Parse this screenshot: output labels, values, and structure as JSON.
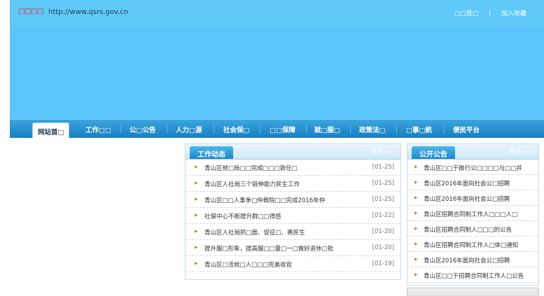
{
  "header": {
    "logo_text": "□□□□",
    "url": "http://www.qsrs.gov.cn",
    "home_link": "□□首□",
    "bookmark_link": "加入收藏",
    "separator": "|"
  },
  "nav": {
    "items": [
      {
        "label": "网站首□"
      },
      {
        "label": "工作□□"
      },
      {
        "label": "公□公告"
      },
      {
        "label": "人力□源"
      },
      {
        "label": "社会保□"
      },
      {
        "label": "□□保障"
      },
      {
        "label": "就□服□"
      },
      {
        "label": "政策法□"
      },
      {
        "label": "□事□航"
      },
      {
        "label": "便民平台"
      }
    ]
  },
  "news": {
    "title": "工作动态",
    "more": "更多 >>",
    "items": [
      {
        "title": "青山区就□局□□完成□□□敦任□",
        "date": "[01-25]"
      },
      {
        "title": "青山区人社局三个链伸助力民生工作",
        "date": "[01-25]"
      },
      {
        "title": "青山区□□人事争□仲裁院□□完成2016年仲",
        "date": "[01-25]"
      },
      {
        "title": "社保中心不断提升群□□得感",
        "date": "[01-22]"
      },
      {
        "title": "青山区人社局抓□面、促征□、惠民生",
        "date": "[01-20]"
      },
      {
        "title": "提升服□形象，提高服□□量□一□做好退休□批",
        "date": "[01-20]"
      },
      {
        "title": "青山区□活就□人□□□完美收官",
        "date": "[01-19]"
      }
    ]
  },
  "notices": {
    "title": "公开公告",
    "more": "更多 >>",
    "items": [
      {
        "title": "青山区□□于推行公□□□□与□□并"
      },
      {
        "title": "青山区2016年面向社会公□招聘"
      },
      {
        "title": "青山区2016年面向社会公□招聘"
      },
      {
        "title": "青山区招聘合同制工作人□□□人□"
      },
      {
        "title": "青山区招聘合同制人□□□的公告"
      },
      {
        "title": "青山区招聘合同制工作人□体□通知"
      },
      {
        "title": "青山区2016年面向社会公□招聘"
      },
      {
        "title": "青山区□□于招聘合同制工作人□公告"
      }
    ]
  },
  "colors": {
    "banner": "#5bc6fb",
    "nav": "#1a7ec0",
    "bullet": "#e0801b"
  }
}
